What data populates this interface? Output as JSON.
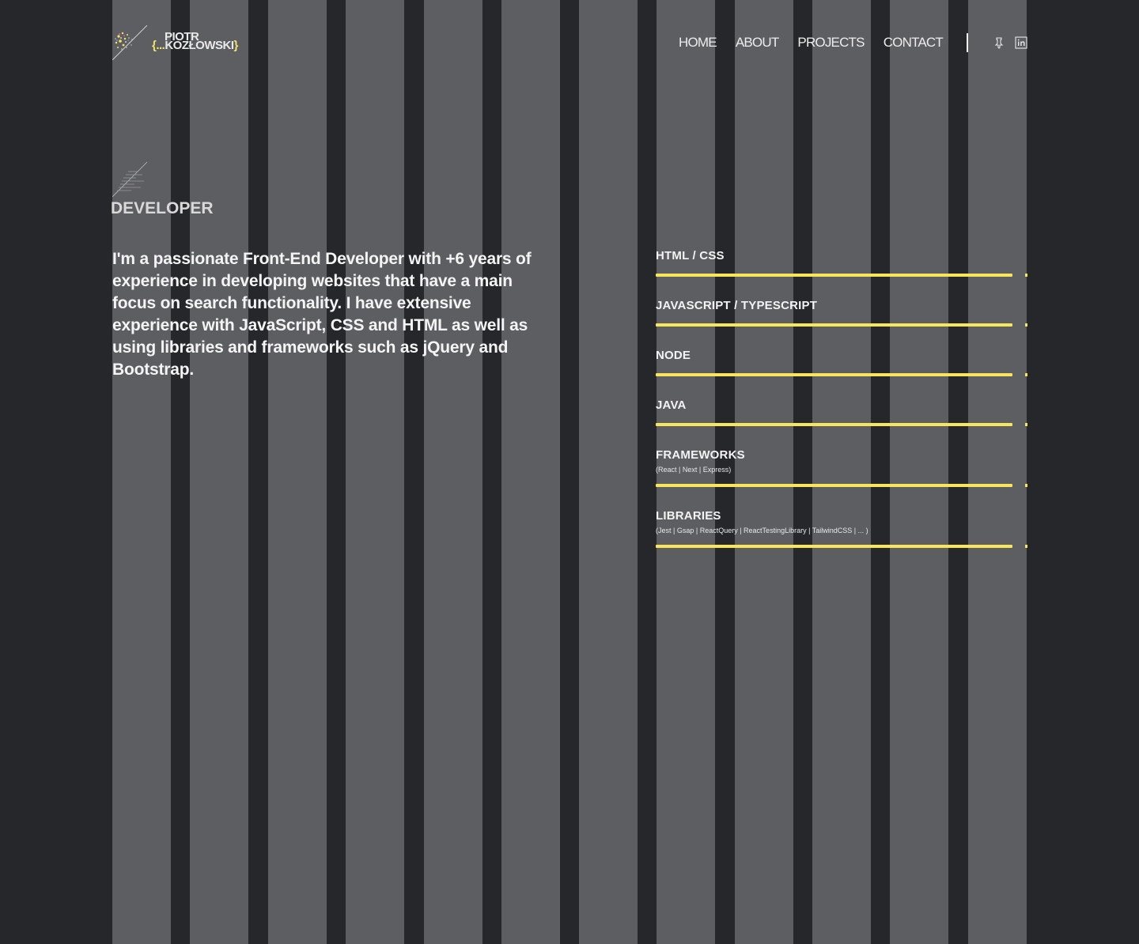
{
  "colors": {
    "background": "#25272b",
    "stripe": "#5d5e62",
    "accent": "#f7e55c",
    "text": "#f2f2f2"
  },
  "header": {
    "logo": {
      "first": "PIOTR",
      "open_brace": "{...",
      "last": "KOZŁOWSKI",
      "close_brace": "}"
    },
    "nav": [
      "HOME",
      "ABOUT",
      "PROJECTS",
      "CONTACT"
    ],
    "social": [
      {
        "name": "github-icon"
      },
      {
        "name": "linkedin-icon"
      }
    ]
  },
  "about": {
    "title": "DEVELOPER",
    "intro": "I'm a passionate Front-End Developer with +6 years of experience in developing websites that have a main focus on search functionality. I have extensive experience with JavaScript, CSS and HTML as well as using libraries and frameworks such as jQuery and Bootstrap."
  },
  "skills": [
    {
      "name": "HTML  / CSS",
      "sub": "",
      "level": 0.96
    },
    {
      "name": "JAVASCRIPT /  TYPESCRIPT",
      "sub": "",
      "level": 0.96
    },
    {
      "name": "NODE",
      "sub": "",
      "level": 0.96
    },
    {
      "name": "JAVA",
      "sub": "",
      "level": 0.96
    },
    {
      "name": "FRAMEWORKS",
      "sub": "(React | Next | Express)",
      "level": 0.96
    },
    {
      "name": "LIBRARIES",
      "sub": "(Jest | Gsap | ReactQuery | ReactTestingLibrary | TailwindCSS | ... )",
      "level": 0.96
    }
  ]
}
